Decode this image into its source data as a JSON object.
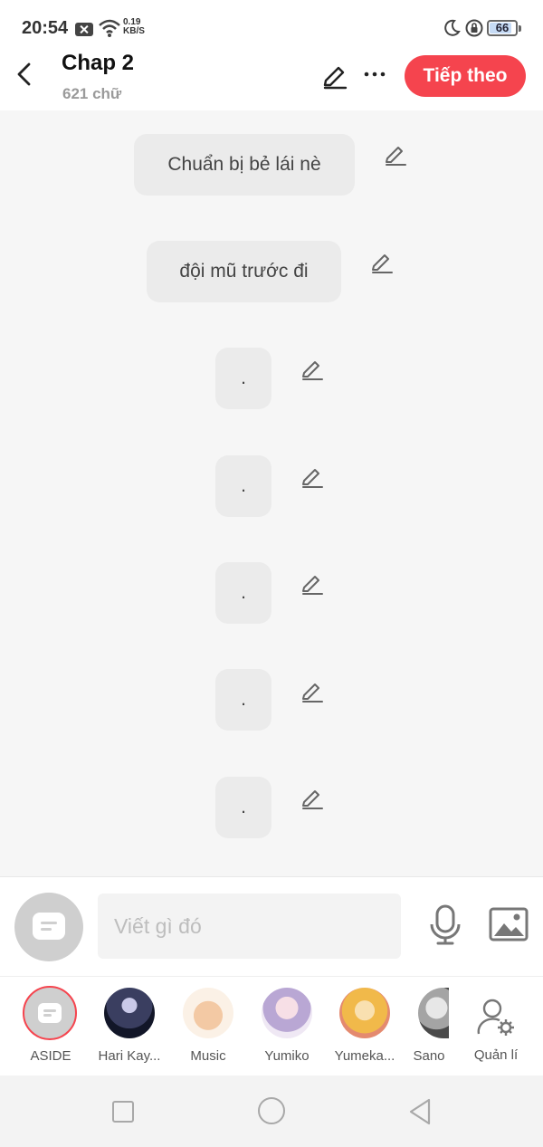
{
  "status_bar": {
    "time": "20:54",
    "speed_value": "0.19",
    "speed_unit": "KB/S",
    "battery": "66"
  },
  "header": {
    "title": "Chap 2",
    "word_count": "621 chữ",
    "next_label": "Tiếp theo"
  },
  "messages": [
    {
      "text": "Chuẩn bị bẻ lái nè"
    },
    {
      "text": "đội mũ trước đi"
    },
    {
      "text": "."
    },
    {
      "text": "."
    },
    {
      "text": "."
    },
    {
      "text": "."
    },
    {
      "text": "."
    }
  ],
  "input": {
    "placeholder": "Viết gì đó"
  },
  "characters": [
    {
      "name": "ASIDE"
    },
    {
      "name": "Hari Kay..."
    },
    {
      "name": "Music"
    },
    {
      "name": "Yumiko"
    },
    {
      "name": "Yumeka..."
    },
    {
      "name": "Sano"
    }
  ],
  "manage_label": "Quản lí",
  "colors": {
    "accent": "#f5444e",
    "bubble": "#ebebeb",
    "background": "#f6f6f6"
  }
}
